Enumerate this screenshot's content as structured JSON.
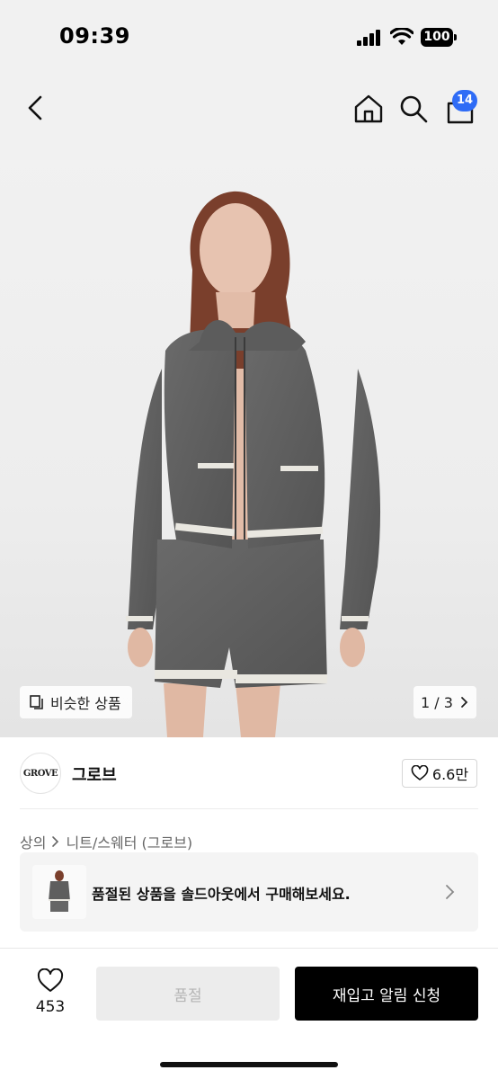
{
  "status_bar": {
    "time": "09:39",
    "battery": "100"
  },
  "nav": {
    "cart_count": "14"
  },
  "hero": {
    "similar_label": "비슷한 상품",
    "page_current": "1",
    "page_total": "3",
    "page_separator": "/"
  },
  "brand": {
    "logo_text": "GROVE",
    "name": "그로브",
    "likes": "6.6만"
  },
  "breadcrumb": {
    "items": [
      "상의",
      "니트/스웨터 (그로브)"
    ]
  },
  "soldout_banner": {
    "message": "품절된 상품을 솔드아웃에서 구매해보세요."
  },
  "bottom_bar": {
    "wish_count": "453",
    "soldout_label": "품절",
    "restock_label": "재입고 알림 신청"
  },
  "colors": {
    "badge": "#2f6cf6",
    "primary_button": "#000000",
    "disabled_button": "#ececec"
  }
}
